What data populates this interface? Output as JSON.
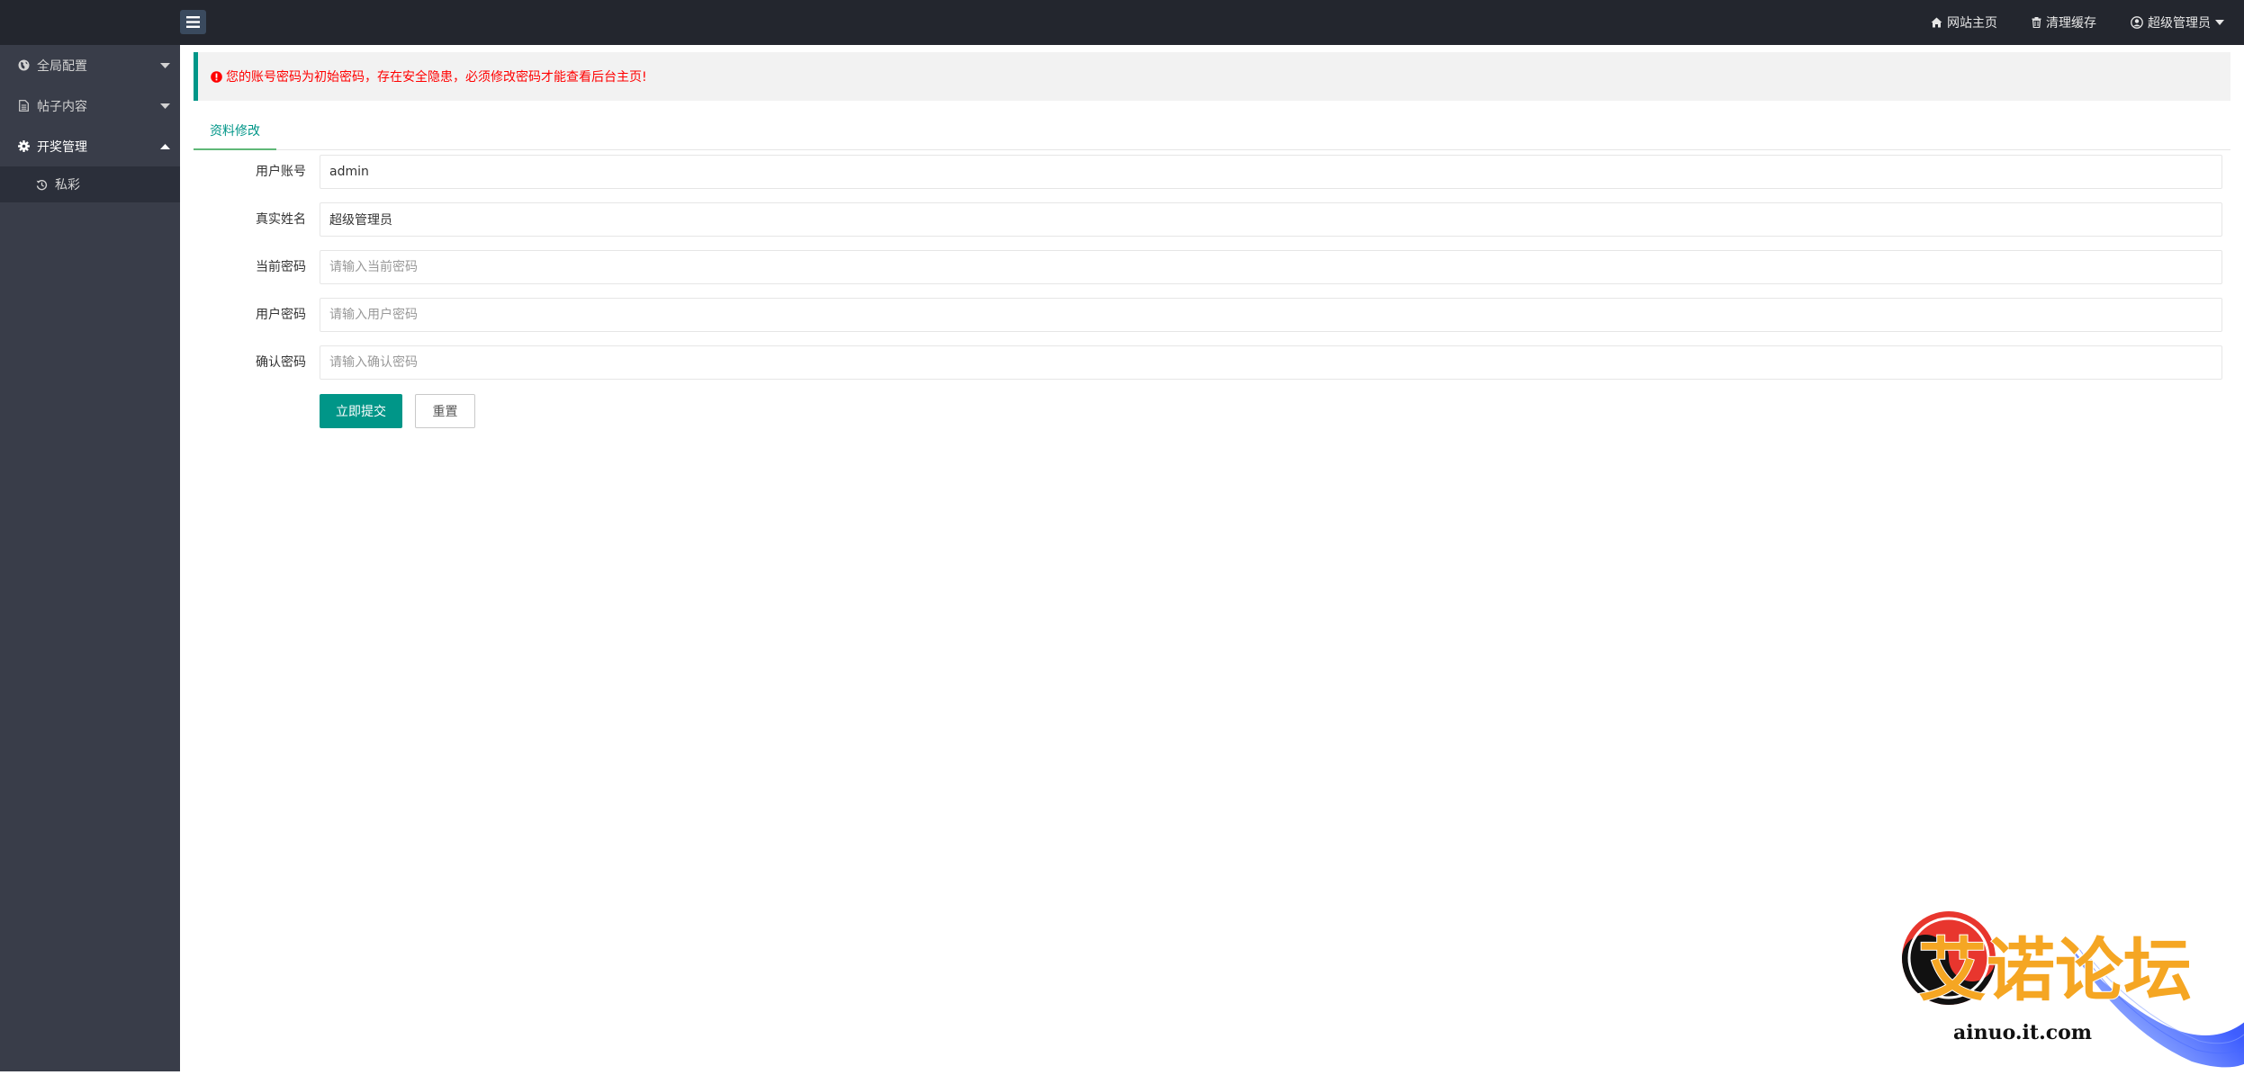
{
  "header": {
    "links": [
      {
        "label": "网站主页",
        "icon": "home-icon"
      },
      {
        "label": "清理缓存",
        "icon": "trash-icon"
      },
      {
        "label": "超级管理员",
        "icon": "user-circle-icon"
      }
    ]
  },
  "sidebar": {
    "items": [
      {
        "label": "全局配置",
        "icon": "globe-icon",
        "expanded": false
      },
      {
        "label": "帖子内容",
        "icon": "document-icon",
        "expanded": false
      },
      {
        "label": "开奖管理",
        "icon": "gear-icon",
        "expanded": true
      }
    ],
    "sub_items": [
      {
        "label": "私彩",
        "icon": "history-icon"
      }
    ]
  },
  "alert": {
    "text": "您的账号密码为初始密码，存在安全隐患，必须修改密码才能查看后台主页!"
  },
  "tabs": [
    {
      "label": "资料修改",
      "active": true
    }
  ],
  "form": {
    "username": {
      "label": "用户账号",
      "value": "admin",
      "placeholder": ""
    },
    "realname": {
      "label": "真实姓名",
      "value": "超级管理员",
      "placeholder": ""
    },
    "current_password": {
      "label": "当前密码",
      "value": "",
      "placeholder": "请输入当前密码"
    },
    "new_password": {
      "label": "用户密码",
      "value": "",
      "placeholder": "请输入用户密码"
    },
    "confirm_password": {
      "label": "确认密码",
      "value": "",
      "placeholder": "请输入确认密码"
    },
    "submit_label": "立即提交",
    "reset_label": "重置"
  },
  "watermark": {
    "title": "艾诺论坛",
    "url": "ainuo.it.com"
  },
  "colors": {
    "header_bg": "#23262e",
    "sidebar_bg": "#393d49",
    "accent": "#009688",
    "alert_text": "#ff0000"
  }
}
